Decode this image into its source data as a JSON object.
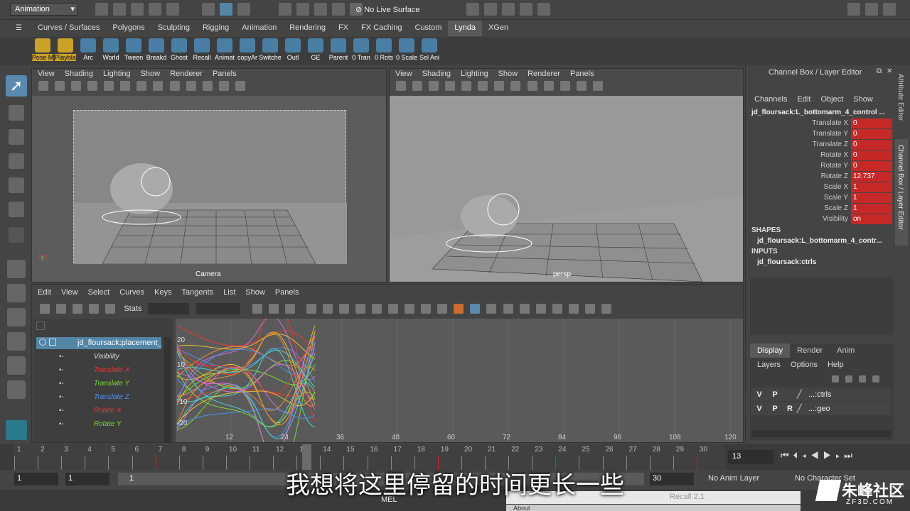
{
  "top_bar": {
    "mode_select": "Animation",
    "live_surface": "No Live Surface"
  },
  "shelf_tabs": [
    "Curves / Surfaces",
    "Polygons",
    "Sculpting",
    "Rigging",
    "Animation",
    "Rendering",
    "FX",
    "FX Caching",
    "Custom",
    "Lynda",
    "XGen"
  ],
  "active_shelf_tab": "Lynda",
  "shelf_items": [
    "Pose M",
    "Playbla",
    "Arc",
    "World",
    "Tween",
    "Breakd",
    "Ghost",
    "Recall",
    "Animat",
    "copyAr",
    "Switche",
    "Outl",
    "GE",
    "Parent",
    "0 Tran",
    "0 Rots",
    "0 Scale",
    "Sel Ani"
  ],
  "viewport_menu": [
    "View",
    "Shading",
    "Lighting",
    "Show",
    "Renderer",
    "Panels"
  ],
  "viewport_left_label": "Camera",
  "viewport_right_label": "persp",
  "graph_menu": [
    "Edit",
    "View",
    "Select",
    "Curves",
    "Keys",
    "Tangents",
    "List",
    "Show",
    "Panels"
  ],
  "graph_stats_label": "Stats",
  "graph_outliner": {
    "root": "jd_floursack:placement_",
    "attrs": [
      {
        "name": "Visibility",
        "color": "#dddddd"
      },
      {
        "name": "Translate X",
        "color": "#e53935"
      },
      {
        "name": "Translate Y",
        "color": "#7cd832"
      },
      {
        "name": "Translate Z",
        "color": "#4f8cf0"
      },
      {
        "name": "Rotate X",
        "color": "#e53935"
      },
      {
        "name": "Rotate Y",
        "color": "#7cd832"
      }
    ]
  },
  "graph_y_ticks": [
    "20",
    "10",
    "-10",
    "-20"
  ],
  "graph_x_ticks": [
    "12",
    "24",
    "36",
    "48",
    "60",
    "72",
    "84",
    "96",
    "108",
    "120"
  ],
  "channel_box": {
    "title": "Channel Box / Layer Editor",
    "menu": [
      "Channels",
      "Edit",
      "Object",
      "Show"
    ],
    "node": "jd_floursack:L_bottomarm_4_control ...",
    "channels": [
      {
        "name": "Translate X",
        "value": "0"
      },
      {
        "name": "Translate Y",
        "value": "0"
      },
      {
        "name": "Translate Z",
        "value": "0"
      },
      {
        "name": "Rotate X",
        "value": "0"
      },
      {
        "name": "Rotate Y",
        "value": "0"
      },
      {
        "name": "Rotate Z",
        "value": "12.737"
      },
      {
        "name": "Scale X",
        "value": "1"
      },
      {
        "name": "Scale Y",
        "value": "1"
      },
      {
        "name": "Scale Z",
        "value": "1"
      },
      {
        "name": "Visibility",
        "value": "on"
      }
    ],
    "shapes_label": "SHAPES",
    "shapes_node": "jd_floursack:L_bottomarm_4_contr...",
    "inputs_label": "INPUTS",
    "inputs_node": "jd_floursack:ctrls",
    "side_tab_top": "Attribute Editor",
    "side_tab_bottom": "Channel Box / Layer Editor"
  },
  "layer_editor": {
    "tabs": [
      "Display",
      "Render",
      "Anim"
    ],
    "menu": [
      "Layers",
      "Options",
      "Help"
    ],
    "layers": [
      {
        "v": "V",
        "p": "P",
        "r": "",
        "name": "...:ctrls"
      },
      {
        "v": "V",
        "p": "P",
        "r": "R",
        "name": "...:geo"
      }
    ]
  },
  "timeline": {
    "frames": [
      "1",
      "2",
      "3",
      "4",
      "5",
      "6",
      "7",
      "8",
      "9",
      "10",
      "11",
      "12",
      "13",
      "14",
      "15",
      "16",
      "17",
      "18",
      "19",
      "20",
      "21",
      "22",
      "23",
      "24",
      "25",
      "26",
      "27",
      "28",
      "29",
      "30"
    ],
    "current_frame": "13",
    "cursor_label": "13"
  },
  "range_bar": {
    "start": "1",
    "start2": "1",
    "range_start": "1",
    "end": "30",
    "anim_layer": "No Anim Layer",
    "character_set": "No Character Set"
  },
  "command_line": {
    "lang": "MEL",
    "result": "Recall 2.1",
    "help": "About"
  },
  "subtitle": "我想将这里停留的时间更长一些",
  "watermark": "朱峰社区",
  "watermark_url": "ZF3D.COM"
}
